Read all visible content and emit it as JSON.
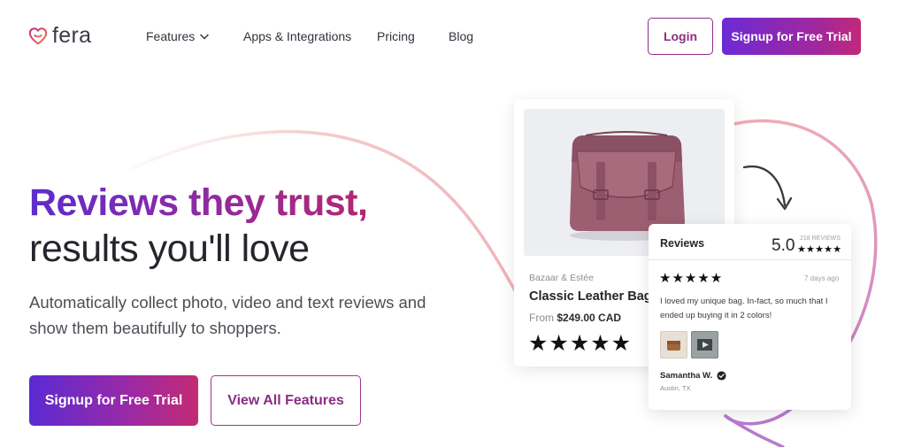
{
  "brand": {
    "logo_text": "fera",
    "accent": "#8d2f86",
    "gradient_start": "#5d2dcc",
    "gradient_end": "#c0297a"
  },
  "nav": {
    "items": [
      {
        "label": "Features",
        "icon": "chevron-down-icon"
      },
      {
        "label": "Apps & Integrations"
      },
      {
        "label": "Pricing"
      },
      {
        "label": "Blog"
      }
    ],
    "login_label": "Login",
    "signup_label": "Signup for Free Trial"
  },
  "hero": {
    "headline_line1": "Reviews they trust,",
    "headline_line2": "results you'll love",
    "subtitle": "Automatically collect photo, video and text reviews and show them beautifully to shoppers.",
    "primary_cta": "Signup for Free Trial",
    "secondary_cta": "View All Features"
  },
  "product_card": {
    "brand": "Bazaar & Estée",
    "name": "Classic Leather Bag",
    "price_prefix": "From",
    "price": "$249.00 CAD",
    "rating_stars": 5
  },
  "reviews_card": {
    "title": "Reviews",
    "score": "5.0",
    "count_label": "218 REVIEWS",
    "review": {
      "stars": 5,
      "date": "7 days ago",
      "text": "I loved my unique bag. In-fact, so much that I ended up buying it in 2 colors!",
      "media": [
        "bag-thumbnail",
        "video-thumbnail"
      ],
      "author": "Samantha W.",
      "location": "Austin, TX",
      "verified_icon": "verified-check-icon"
    }
  }
}
